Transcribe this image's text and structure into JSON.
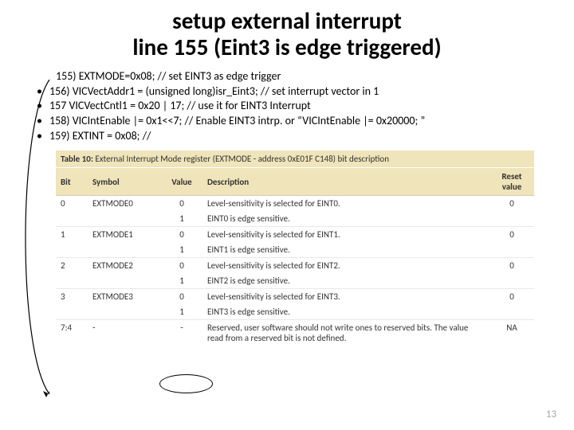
{
  "title_line1": "setup external interrupt",
  "title_line2": "line 155 (Eint3 is edge triggered)",
  "code_lines": [
    "155) EXTMODE=0x08;     // set EINT3 as edge trigger",
    "156)   VICVectAddr1 = (unsigned long)isr_Eint3; // set interrupt vector in 1",
    "157   VICVectCntl1 = 0x20 | 17;                         // use it for EINT3 Interrupt",
    "158)    VICIntEnable |= 0x1<<7; // Enable EINT3 intrp. or “VICIntEnable |= 0x20000; ”",
    "159)    EXTINT = 0x08;                                             //"
  ],
  "table_caption_num": "Table 10:",
  "table_caption_text": "External Interrupt Mode register (EXTMODE - address 0xE01F C148) bit description",
  "headers": {
    "bit": "Bit",
    "symbol": "Symbol",
    "value": "Value",
    "desc": "Description",
    "reset": "Reset value"
  },
  "rows": [
    {
      "bit": "0",
      "symbol": "EXTMODE0",
      "value": "0",
      "desc": "Level-sensitivity is selected for EINT0.",
      "reset": "0",
      "border": true
    },
    {
      "bit": "",
      "symbol": "",
      "value": "1",
      "desc": "EINT0 is edge sensitive.",
      "reset": "",
      "border": false
    },
    {
      "bit": "1",
      "symbol": "EXTMODE1",
      "value": "0",
      "desc": "Level-sensitivity is selected for EINT1.",
      "reset": "0",
      "border": true
    },
    {
      "bit": "",
      "symbol": "",
      "value": "1",
      "desc": "EINT1 is edge sensitive.",
      "reset": "",
      "border": false
    },
    {
      "bit": "2",
      "symbol": "EXTMODE2",
      "value": "0",
      "desc": "Level-sensitivity is selected for EINT2.",
      "reset": "0",
      "border": true
    },
    {
      "bit": "",
      "symbol": "",
      "value": "1",
      "desc": "EINT2 is edge sensitive.",
      "reset": "",
      "border": false
    },
    {
      "bit": "3",
      "symbol": "EXTMODE3",
      "value": "0",
      "desc": "Level-sensitivity is selected for EINT3.",
      "reset": "0",
      "border": true
    },
    {
      "bit": "",
      "symbol": "",
      "value": "1",
      "desc": "EINT3 is edge sensitive.",
      "reset": "",
      "border": false
    },
    {
      "bit": "7:4",
      "symbol": "-",
      "value": "-",
      "desc": "Reserved, user software should not write ones to reserved bits. The value read from a reserved bit is not defined.",
      "reset": "NA",
      "border": true
    }
  ],
  "page_number": "13"
}
